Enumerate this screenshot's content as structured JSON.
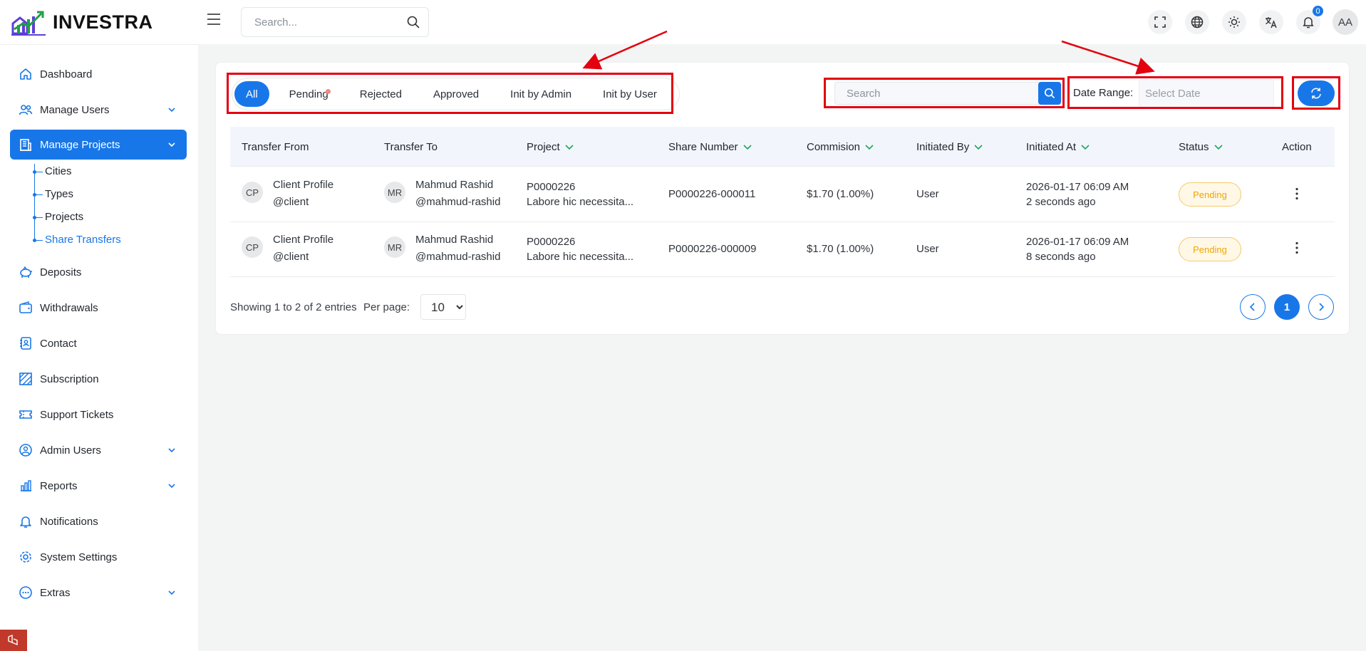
{
  "brand": {
    "name": "INVESTRA"
  },
  "header": {
    "search_placeholder": "Search...",
    "notification_count": "0",
    "user_initials": "AA",
    "buttons": [
      "fullscreen-icon",
      "globe-icon",
      "sun-icon",
      "translate-icon",
      "bell-icon"
    ]
  },
  "sidebar": {
    "items": [
      {
        "label": "Dashboard",
        "icon": "home-icon"
      },
      {
        "label": "Manage Users",
        "icon": "users-icon",
        "expandable": true
      },
      {
        "label": "Manage Projects",
        "icon": "building-icon",
        "expandable": true,
        "active": true
      },
      {
        "label": "Deposits",
        "icon": "piggy-bank-icon"
      },
      {
        "label": "Withdrawals",
        "icon": "wallet-icon"
      },
      {
        "label": "Contact",
        "icon": "contact-icon"
      },
      {
        "label": "Subscription",
        "icon": "subscription-icon"
      },
      {
        "label": "Support Tickets",
        "icon": "ticket-icon"
      },
      {
        "label": "Admin Users",
        "icon": "admin-user-icon",
        "expandable": true
      },
      {
        "label": "Reports",
        "icon": "chart-icon",
        "expandable": true
      },
      {
        "label": "Notifications",
        "icon": "bell-icon"
      },
      {
        "label": "System Settings",
        "icon": "gear-icon"
      },
      {
        "label": "Extras",
        "icon": "more-icon",
        "expandable": true
      }
    ],
    "sub_items": [
      {
        "label": "Cities"
      },
      {
        "label": "Types"
      },
      {
        "label": "Projects"
      },
      {
        "label": "Share Transfers",
        "active": true
      }
    ]
  },
  "filters": {
    "tabs": [
      "All",
      "Pending",
      "Rejected",
      "Approved",
      "Init by Admin",
      "Init by User"
    ],
    "active_tab": "All",
    "search_placeholder": "Search",
    "date_label": "Date Range:",
    "date_placeholder": "Select Date"
  },
  "table": {
    "columns": [
      "Transfer From",
      "Transfer To",
      "Project",
      "Share Number",
      "Commision",
      "Initiated By",
      "Initiated At",
      "Status",
      "Action"
    ],
    "rows": [
      {
        "from_initials": "CP",
        "from_name": "Client Profile",
        "from_handle": "@client",
        "to_initials": "MR",
        "to_name": "Mahmud Rashid",
        "to_handle": "@mahmud-rashid",
        "project_code": "P0000226",
        "project_desc": "Labore hic necessita...",
        "share_number": "P0000226-000011",
        "commission": "$1.70 (1.00%)",
        "initiated_by": "User",
        "initiated_at": "2026-01-17 06:09 AM",
        "initiated_ago": "2 seconds ago",
        "status": "Pending"
      },
      {
        "from_initials": "CP",
        "from_name": "Client Profile",
        "from_handle": "@client",
        "to_initials": "MR",
        "to_name": "Mahmud Rashid",
        "to_handle": "@mahmud-rashid",
        "project_code": "P0000226",
        "project_desc": "Labore hic necessita...",
        "share_number": "P0000226-000009",
        "commission": "$1.70 (1.00%)",
        "initiated_by": "User",
        "initiated_at": "2026-01-17 06:09 AM",
        "initiated_ago": "8 seconds ago",
        "status": "Pending"
      }
    ]
  },
  "footer": {
    "info": "Showing 1 to 2 of 2 entries",
    "per_page_label": "Per page:",
    "per_page_value": "10",
    "current_page": "1"
  },
  "colors": {
    "accent": "#1877e8",
    "annotation": "#e3000f",
    "pending": "#f0a500"
  }
}
